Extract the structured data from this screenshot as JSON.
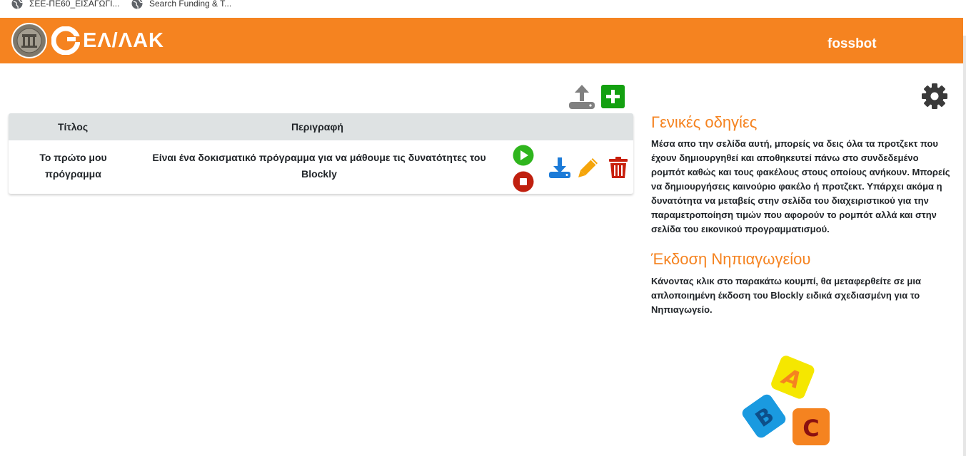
{
  "bookmarks": [
    {
      "label": "ΣΕΕ-ΠΕ60_ΕΙΣΑΓΩΓΙ...",
      "icon": "globe-icon"
    },
    {
      "label": "Search Funding & T...",
      "icon": "globe-icon"
    }
  ],
  "navbar": {
    "logo_text": "ΕΛ/ΛΑΚ",
    "brand": "fossbot",
    "color": "#f58320"
  },
  "toolbar": {
    "upload_icon": "upload-icon",
    "add_icon": "plus-icon"
  },
  "table": {
    "headers": [
      "Τίτλος",
      "Περιγραφή"
    ],
    "rows": [
      {
        "title": [
          "Το πρώτο μου",
          "πρόγραμμα"
        ],
        "description": [
          "Είναι ένα δοκισματικό πρόγραμμα για να μάθουμε τις δυνατότητες του",
          "Blockly"
        ],
        "actions": [
          "play-icon",
          "stop-icon",
          "download-icon",
          "edit-icon",
          "delete-icon"
        ]
      }
    ]
  },
  "sidebar": {
    "settings_icon": "gear-icon",
    "general_title": "Γενικές οδηγίες",
    "general_lines": [
      "Μέσα απο την σελίδα αυτή, μπορείς να δεις όλα τα προτζεκτ που",
      "έχουν δημιουργηθεί και αποθηκευτεί πάνω στο συνδεδεμένο",
      "ρομπότ καθώς και τους φακέλους στους οποίους ανήκουν. Μπορείς",
      "να δημιουργήσεις καινούριο φακέλο ή προτζεκτ. Υπάρχει ακόμα η",
      "δυνατότητα να μεταβείς στην σελίδα του διαχειριστικού για την",
      "παραμετροποίηση τιμών που αφορούν το ρομπότ αλλά και στην",
      "σελίδα του εικονικού προγραμματισμού."
    ],
    "kindergarten_title": "Έκδοση Νηπιαγωγείου",
    "kindergarten_lines": [
      "Κάνοντας κλικ στο παρακάτω κουμπί, θα μεταφερθείτε σε μια",
      "απλοποιημένη έκδοση του Blockly ειδικά σχεδιασμένη για το",
      "Νηπιαγωγείο."
    ],
    "abc_blocks": [
      "A",
      "B",
      "C"
    ]
  }
}
